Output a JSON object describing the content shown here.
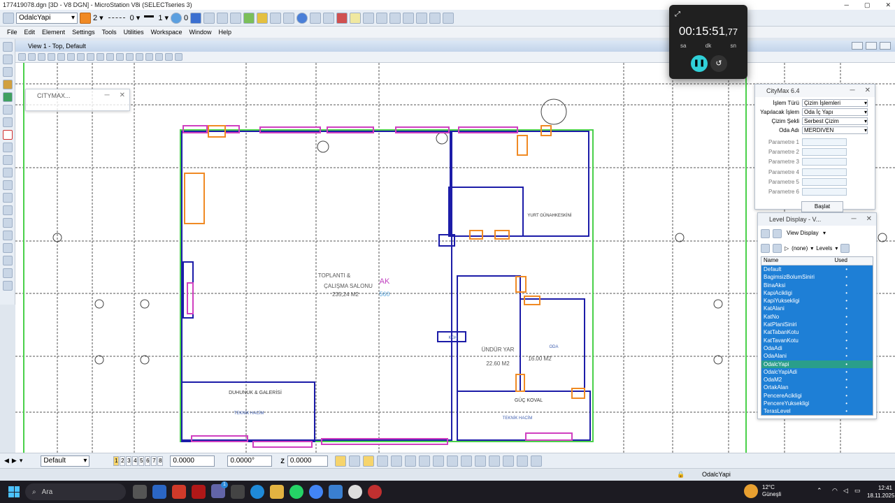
{
  "window": {
    "title": "177419078.dgn [3D - V8 DGN] - MicroStation V8i (SELECTseries 3)"
  },
  "toolbar": {
    "active_level": "OdalcYapi",
    "color_value": "2",
    "style_value": "0",
    "weight_value": "1",
    "transparency_value": "0"
  },
  "menu": {
    "items": [
      "File",
      "Edit",
      "Element",
      "Settings",
      "Tools",
      "Utilities",
      "Workspace",
      "Window",
      "Help"
    ]
  },
  "view": {
    "title": "View 1 - Top, Default"
  },
  "citymax_small": {
    "title": "CITYMAX..."
  },
  "drawing": {
    "room1_line1": "TOPLANTI &",
    "room1_line2": "ÇALIŞMA SALONU",
    "room1_area": "235,24 M2",
    "stamp_code": "AK",
    "stamp_num": "560",
    "room2_line1": "ÜNDÜR YAR",
    "room2_area": "22.60 M2",
    "room3_area": "16.00 M2",
    "label_oda": "ODA",
    "label_kgh": "KGH",
    "room4": "DUHUNUK & GALERİSİ",
    "room4_sub": "TEKNİK HACİM",
    "room5": "YURT GÜNAHKESKİNİ",
    "room6_line1": "GÜÇ KOVAL",
    "room6_sub": "TEKNİK HACİM"
  },
  "citymax": {
    "title": "CityMax 6.4",
    "fields": [
      {
        "label": "İşlem Türü",
        "value": "Çizim İşlemleri"
      },
      {
        "label": "Yapılacak İşlem",
        "value": "Oda İç Yapı"
      },
      {
        "label": "Çizim Şekli",
        "value": "Serbest Çizim"
      },
      {
        "label": "Oda Adı",
        "value": "MERDIVEN"
      }
    ],
    "params": [
      "Parametre 1",
      "Parametre 2",
      "Parametre 3",
      "Parametre 4",
      "Parametre 5",
      "Parametre 6"
    ],
    "start_button": "Başlat"
  },
  "level_display": {
    "title": "Level Display - V...",
    "view_select": "View Display",
    "filter_select": "(none)",
    "levels_select": "Levels",
    "col_name": "Name",
    "col_used": "Used",
    "levels": [
      "Default",
      "BagimsizBolumSiniri",
      "BinaAksi",
      "KapiAcikligi",
      "KapiYuksekligi",
      "KatAlani",
      "KatNo",
      "KatPlaniSiniri",
      "KatTabanKotu",
      "KatTavanKotu",
      "OdaAdi",
      "OdaAlani",
      "OdalcYapi",
      "OdalcYapiAdi",
      "OdaM2",
      "OrtakAlan",
      "PencereAcikligi",
      "PencereYuksekligi",
      "TerasLevel"
    ],
    "used_mark": "•",
    "selected_index": 12
  },
  "timer": {
    "time_main": "00:15:51",
    "time_frac": ",77",
    "unit_h": "sa",
    "unit_m": "dk",
    "unit_s": "sn"
  },
  "bottom": {
    "view_attr": "Default",
    "view_numbers": [
      "1",
      "2",
      "3",
      "4",
      "5",
      "6",
      "7",
      "8"
    ],
    "x_val": "0.0000",
    "angle_val": "0.0000°",
    "z_label": "Z",
    "z_val": "0.0000"
  },
  "status": {
    "level": "OdalcYapi"
  },
  "taskbar": {
    "search_placeholder": "Ara",
    "weather_temp": "12°C",
    "weather_text": "Güneşli",
    "time": "12:41",
    "date": "18.11.2025",
    "notification_count": "1"
  }
}
